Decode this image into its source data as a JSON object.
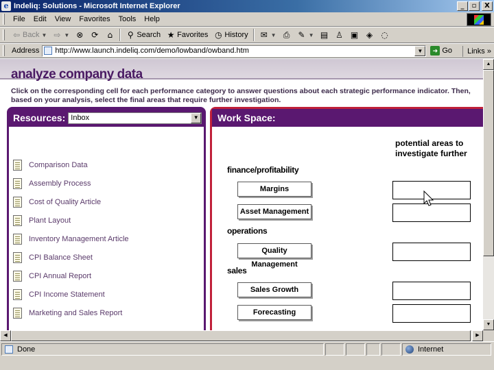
{
  "window": {
    "title": "Indeliq: Solutions - Microsoft Internet Explorer",
    "buttons": [
      "_",
      "▫",
      "X"
    ]
  },
  "menu": [
    "File",
    "Edit",
    "View",
    "Favorites",
    "Tools",
    "Help"
  ],
  "toolbar": {
    "back": "Back",
    "search": "Search",
    "favorites": "Favorites",
    "history": "History"
  },
  "address": {
    "label": "Address",
    "url": "http://www.launch.indeliq.com/demo/lowband/owband.htm",
    "go": "Go",
    "links": "Links"
  },
  "page": {
    "title": "analyze company data",
    "instructions": "Click on the corresponding cell for each performance category to answer questions about each strategic performance indicator. Then, based on your analysis, select the final areas that require further investigation."
  },
  "resources": {
    "title": "Resources:",
    "selected": "Inbox",
    "items": [
      "Comparison Data",
      "Assembly Process",
      "Cost of Quality Article",
      "Plant Layout",
      "Inventory Management Article",
      "CPI Balance Sheet",
      "CPI Annual Report",
      "CPI Income Statement",
      "Marketing and Sales Report"
    ]
  },
  "workspace": {
    "title": "Work Space:",
    "column_header": "potential areas to investigate further",
    "sections": {
      "finance": "finance/profitability",
      "operations": "operations",
      "sales": "sales"
    },
    "buttons": {
      "margins": "Margins",
      "asset_management": "Asset Management",
      "quality_management": "Quality Management",
      "sales_growth": "Sales Growth",
      "forecasting": "Forecasting"
    }
  },
  "status": {
    "left": "Done",
    "zone": "Internet"
  }
}
